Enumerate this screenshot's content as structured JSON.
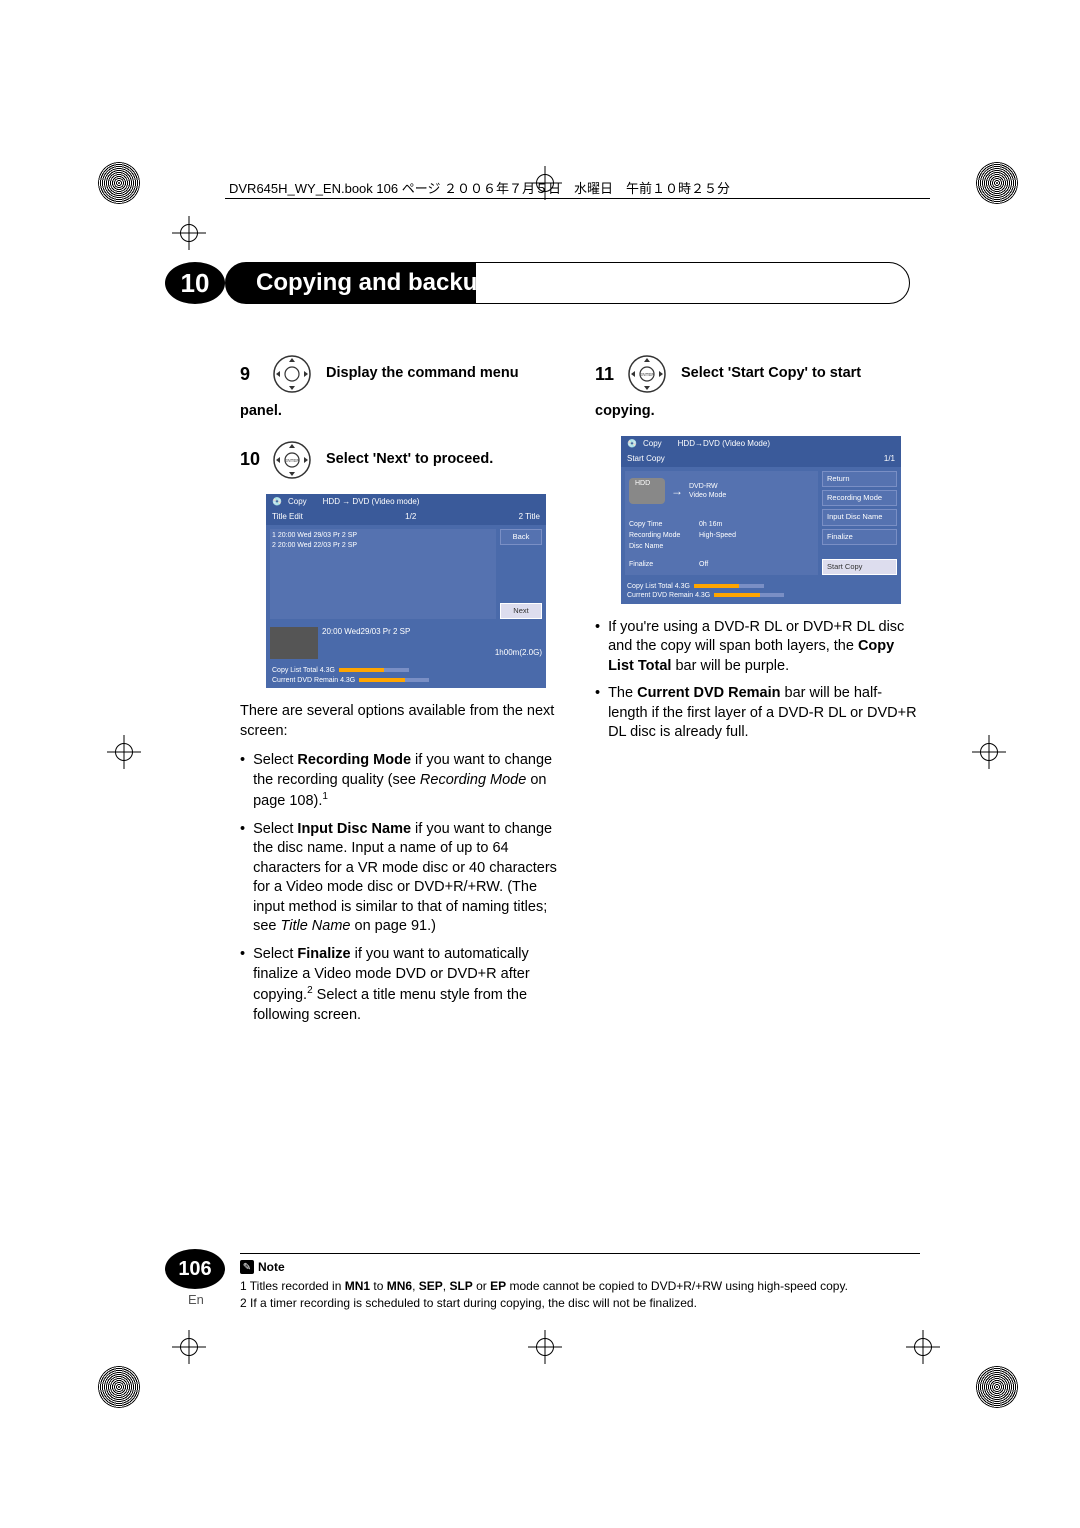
{
  "header_text": "DVR645H_WY_EN.book  106 ページ  ２００６年７月５日　水曜日　午前１０時２５分",
  "chapter": {
    "number": "10",
    "title": "Copying and backup"
  },
  "left_col": {
    "step9_num": "9",
    "step9_text": "Display the command menu",
    "step9_cont": "panel.",
    "step10_num": "10",
    "step10_text": "Select 'Next' to proceed.",
    "intro": "There are several options available from the next screen:",
    "bullet1_a": "Select ",
    "bullet1_b": "Recording Mode",
    "bullet1_c": " if you want to change the recording quality (see ",
    "bullet1_d": "Recording Mode",
    "bullet1_e": " on page 108).",
    "bullet1_sup": "1",
    "bullet2_a": "Select ",
    "bullet2_b": "Input Disc Name",
    "bullet2_c": " if you want to change the disc name. Input a name of up to 64 characters for a VR mode disc or 40 characters for a Video mode disc or DVD+R/+RW. (The input method is similar to that of naming titles; see ",
    "bullet2_d": "Title Name",
    "bullet2_e": " on page 91.)",
    "bullet3_a": "Select ",
    "bullet3_b": "Finalize",
    "bullet3_c": " if you want to automatically finalize a Video mode DVD or DVD+R after copying.",
    "bullet3_sup": "2",
    "bullet3_d": " Select a title menu style from the following screen."
  },
  "right_col": {
    "step11_num": "11",
    "step11_text": "Select 'Start Copy' to start",
    "step11_cont": "copying.",
    "bullet1_a": "If you're using a DVD-R DL or DVD+R DL disc and the copy will span both layers, the ",
    "bullet1_b": "Copy List Total",
    "bullet1_c": " bar will be purple.",
    "bullet2_a": "The ",
    "bullet2_b": "Current DVD Remain",
    "bullet2_c": " bar will be half-length if the first layer of a DVD-R DL or DVD+R DL disc is already full."
  },
  "screenshot1": {
    "title": "Copy",
    "mode": "HDD → DVD (Video mode)",
    "subheader_left": "Title Edit",
    "subheader_mid": "1/2",
    "subheader_right": "2   Title",
    "row1": "1     20:00   Wed          29/03   Pr 2   SP",
    "row2": "2     20:00   Wed          22/03   Pr 2   SP",
    "btn_back": "Back",
    "btn_next": "Next",
    "preview_info": "20:00      Wed29/03      Pr 2    SP",
    "preview_time": "1h00m(2.0G)",
    "footer1": "Copy List Total               4.3G",
    "footer2": "Current DVD Remain      4.3G"
  },
  "screenshot2": {
    "title": "Copy",
    "mode": "HDD→DVD (Video Mode)",
    "subheader": "Start Copy",
    "subheader_right": "1/1",
    "hdd": "HDD",
    "dvdrw": "DVD-RW\nVideo Mode",
    "copy_time_k": "Copy Time",
    "copy_time_v": "0h 16m",
    "rec_mode_k": "Recording Mode",
    "rec_mode_v": "High-Speed",
    "disc_name_k": "Disc Name",
    "finalize_k": "Finalize",
    "finalize_v": "Off",
    "footer1": "Copy List Total               4.3G",
    "footer2": "Current DVD Remain      4.3G",
    "btn_return": "Return",
    "btn_rec": "Recording Mode",
    "btn_input": "Input Disc Name",
    "btn_finalize": "Finalize",
    "btn_start": "Start Copy"
  },
  "footnotes": {
    "note_label": "Note",
    "fn1": "1 Titles recorded in MN1 to MN6, SEP, SLP or EP mode cannot be copied to DVD+R/+RW using high-speed copy.",
    "fn2": "2 If a timer recording is scheduled to start during copying, the disc will not be finalized.",
    "mn1": "MN1",
    "mn6": "MN6",
    "sep": "SEP",
    "slp": "SLP",
    "ep": "EP"
  },
  "page": {
    "number": "106",
    "lang": "En"
  }
}
